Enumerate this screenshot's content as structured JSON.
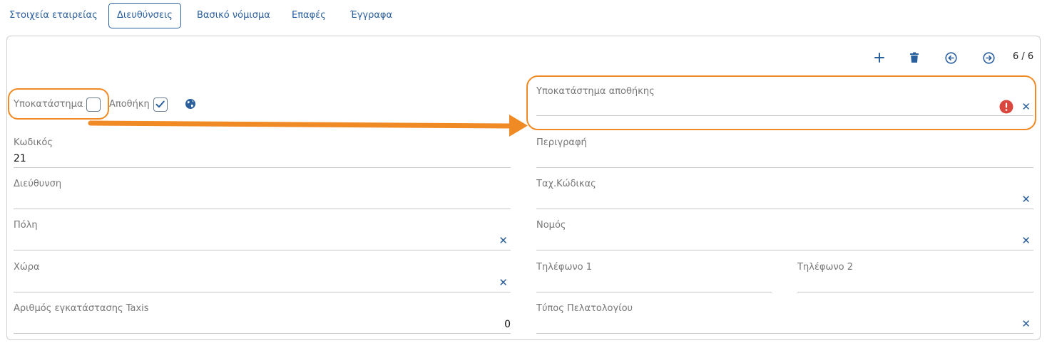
{
  "tabs": [
    {
      "label": "Στοιχεία εταιρείας"
    },
    {
      "label": "Διευθύνσεις"
    },
    {
      "label": "Βασικό νόμισμα"
    },
    {
      "label": "Επαφές"
    },
    {
      "label": "Έγγραφα"
    }
  ],
  "toolbar": {
    "pager": "6 / 6"
  },
  "checks": {
    "branch_label": "Υποκατάστημα",
    "branch_checked": false,
    "warehouse_label": "Αποθήκη",
    "warehouse_checked": true
  },
  "fields": {
    "warehouse_branch": {
      "label": "Υποκατάστημα αποθήκης",
      "value": ""
    },
    "code": {
      "label": "Κωδικός",
      "value": "21"
    },
    "description": {
      "label": "Περιγραφή",
      "value": ""
    },
    "address": {
      "label": "Διεύθυνση",
      "value": ""
    },
    "postal_code": {
      "label": "Ταχ.Κώδικας",
      "value": ""
    },
    "city": {
      "label": "Πόλη",
      "value": ""
    },
    "prefecture": {
      "label": "Νομός",
      "value": ""
    },
    "country": {
      "label": "Χώρα",
      "value": ""
    },
    "phone1": {
      "label": "Τηλέφωνο 1",
      "value": ""
    },
    "phone2": {
      "label": "Τηλέφωνο 2",
      "value": ""
    },
    "taxis_number": {
      "label": "Αριθμός εγκατάστασης Taxis",
      "value": "0"
    },
    "ledger_type": {
      "label": "Τύπος Πελατολογίου",
      "value": ""
    }
  },
  "colors": {
    "accent": "#2a5f9e",
    "highlight": "#f08a24",
    "error": "#d9473f"
  }
}
